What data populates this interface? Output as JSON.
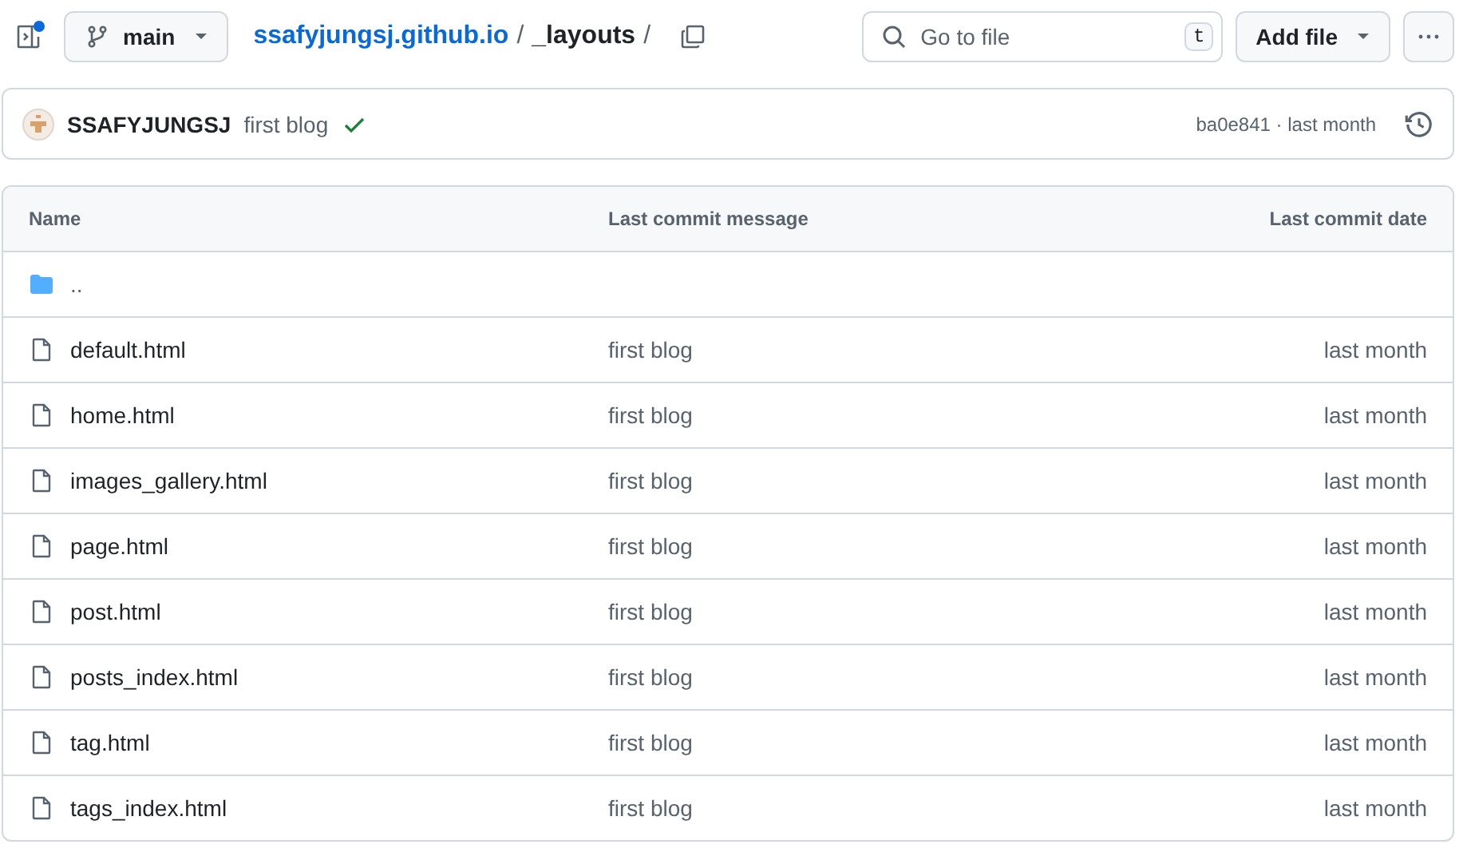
{
  "toolbar": {
    "branch": "main",
    "breadcrumb": [
      {
        "text": "ssafyjungsj.github.io",
        "kind": "link"
      },
      {
        "text": "/",
        "kind": "sep"
      },
      {
        "text": "_layouts",
        "kind": "current"
      },
      {
        "text": "/",
        "kind": "sep"
      }
    ],
    "search": {
      "placeholder": "Go to file",
      "shortcut": "t"
    },
    "add_file": "Add file"
  },
  "commit": {
    "author": "SSAFYJUNGSJ",
    "message": "first blog",
    "checks_passed": true,
    "sha": "ba0e841",
    "separator": "·",
    "time": "last month"
  },
  "table": {
    "columns": [
      "Name",
      "Last commit message",
      "Last commit date"
    ],
    "rows": [
      {
        "kind": "parent",
        "name": ".."
      },
      {
        "kind": "file",
        "name": "default.html",
        "message": "first blog",
        "date": "last month"
      },
      {
        "kind": "file",
        "name": "home.html",
        "message": "first blog",
        "date": "last month"
      },
      {
        "kind": "file",
        "name": "images_gallery.html",
        "message": "first blog",
        "date": "last month"
      },
      {
        "kind": "file",
        "name": "page.html",
        "message": "first blog",
        "date": "last month"
      },
      {
        "kind": "file",
        "name": "post.html",
        "message": "first blog",
        "date": "last month"
      },
      {
        "kind": "file",
        "name": "posts_index.html",
        "message": "first blog",
        "date": "last month"
      },
      {
        "kind": "file",
        "name": "tag.html",
        "message": "first blog",
        "date": "last month"
      },
      {
        "kind": "file",
        "name": "tags_index.html",
        "message": "first blog",
        "date": "last month"
      }
    ]
  }
}
